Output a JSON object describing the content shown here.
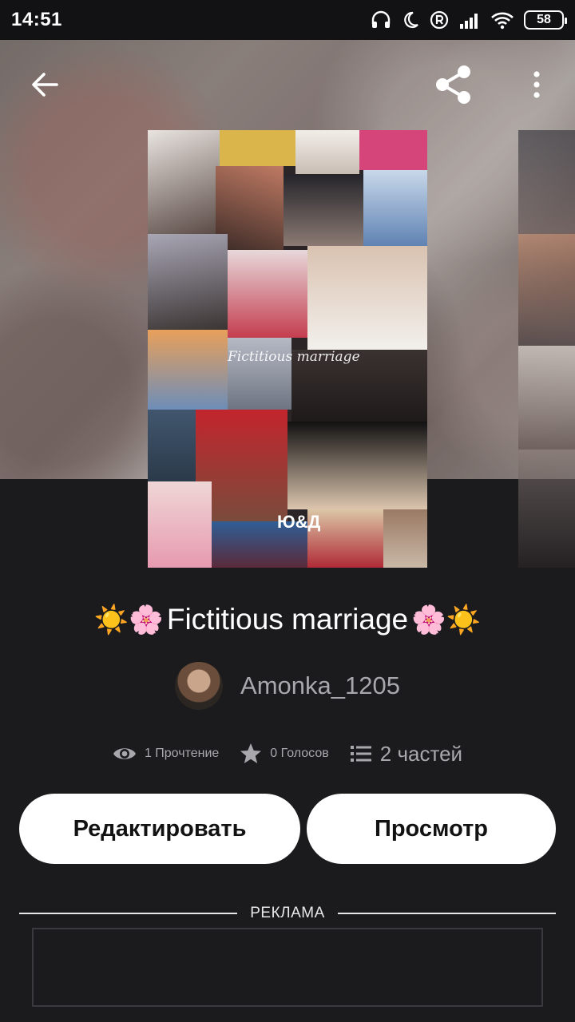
{
  "status_bar": {
    "time": "14:51",
    "battery": "58",
    "icons": [
      "headphones-icon",
      "moon-icon",
      "registered-icon",
      "signal-icon",
      "wifi-icon",
      "battery-icon"
    ]
  },
  "toolbar": {
    "back_icon": "arrow-left-icon",
    "share_icon": "share-icon",
    "more_icon": "more-vertical-icon"
  },
  "cover": {
    "caption": "Fictitious marriage",
    "initials": "Ю&Д"
  },
  "story": {
    "title_prefix": "☀️🌸",
    "title": "Fictitious marriage",
    "title_suffix": "🌸☀️",
    "author": "Amonka_1205"
  },
  "stats": {
    "reads": "1 Прочтение",
    "votes": "0 Голосов",
    "parts": "2 частей"
  },
  "actions": {
    "edit_label": "Редактировать",
    "view_label": "Просмотр"
  },
  "ad": {
    "label": "РЕКЛАМА"
  },
  "colors": {
    "background": "#1b1a1d",
    "button_bg": "#ffffff",
    "muted_text": "#a8a7ab",
    "accent_pink": "#d6457a",
    "sun_yellow": "#f5b514"
  }
}
